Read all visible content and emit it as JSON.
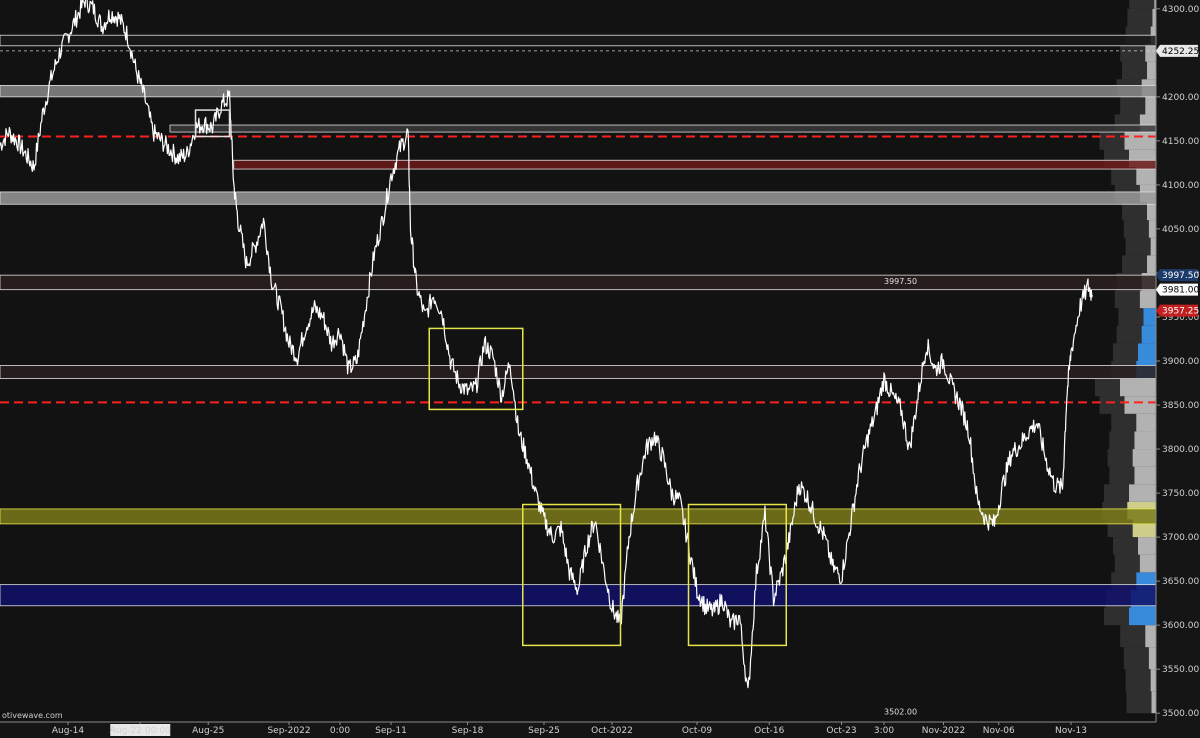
{
  "watermark": "otivewave.com",
  "chart_data": {
    "type": "line",
    "title": "",
    "xlabel": "",
    "ylabel": "",
    "ylim": [
      3490,
      4310
    ],
    "grid": false,
    "y_ticks": [
      3500,
      3550,
      3600,
      3650,
      3700,
      3750,
      3800,
      3850,
      3900,
      3950,
      4000,
      4050,
      4100,
      4150,
      4200,
      4250,
      4300
    ],
    "y_tick_labels": [
      "3500.00",
      "3550.00",
      "3600.00",
      "3650.00",
      "3700.00",
      "3750.00",
      "3800.00",
      "3850.00",
      "3900.00",
      "3950.00",
      "4000.00",
      "4050.00",
      "4100.00",
      "4150.00",
      "4200.00",
      "4250.00",
      "4300.00"
    ],
    "x_labels": [
      {
        "label": "Aug-14",
        "t": 8
      },
      {
        "label": "Aug-22 00:00",
        "t": 16.5,
        "highlight": true
      },
      {
        "label": "Aug-25",
        "t": 24.5
      },
      {
        "label": "Sep-2022",
        "t": 34
      },
      {
        "label": "0:00",
        "t": 40
      },
      {
        "label": "Sep-11",
        "t": 46
      },
      {
        "label": "Sep-18",
        "t": 55
      },
      {
        "label": "Sep-25",
        "t": 64
      },
      {
        "label": "Oct-2022",
        "t": 72
      },
      {
        "label": "Oct-09",
        "t": 82
      },
      {
        "label": "Oct-16",
        "t": 90.5
      },
      {
        "label": "Oct-23",
        "t": 99
      },
      {
        "label": "3:00",
        "t": 104
      },
      {
        "label": "Nov-2022",
        "t": 111
      },
      {
        "label": "Nov-06",
        "t": 117.5
      },
      {
        "label": "Nov-13",
        "t": 126
      }
    ],
    "t_range": [
      0,
      136
    ],
    "series": [
      {
        "color": "#ffffff",
        "points": [
          [
            0,
            4145
          ],
          [
            1,
            4160
          ],
          [
            2,
            4150
          ],
          [
            3,
            4135
          ],
          [
            4,
            4120
          ],
          [
            5,
            4180
          ],
          [
            6,
            4220
          ],
          [
            7,
            4250
          ],
          [
            8,
            4270
          ],
          [
            9,
            4290
          ],
          [
            10,
            4310
          ],
          [
            11,
            4300
          ],
          [
            12,
            4280
          ],
          [
            13,
            4295
          ],
          [
            14,
            4290
          ],
          [
            15,
            4270
          ],
          [
            16,
            4230
          ],
          [
            17,
            4200
          ],
          [
            18,
            4160
          ],
          [
            19,
            4150
          ],
          [
            20,
            4140
          ],
          [
            21,
            4130
          ],
          [
            22,
            4135
          ],
          [
            23,
            4165
          ],
          [
            24,
            4170
          ],
          [
            25,
            4165
          ],
          [
            26,
            4190
          ],
          [
            27,
            4200
          ],
          [
            27.5,
            4100
          ],
          [
            28,
            4060
          ],
          [
            29,
            4010
          ],
          [
            30,
            4030
          ],
          [
            31,
            4060
          ],
          [
            32,
            3990
          ],
          [
            33,
            3960
          ],
          [
            34,
            3920
          ],
          [
            35,
            3905
          ],
          [
            36,
            3940
          ],
          [
            37,
            3960
          ],
          [
            38,
            3950
          ],
          [
            39,
            3920
          ],
          [
            40,
            3935
          ],
          [
            41,
            3890
          ],
          [
            42,
            3900
          ],
          [
            43,
            3960
          ],
          [
            44,
            4020
          ],
          [
            45,
            4060
          ],
          [
            46,
            4110
          ],
          [
            47,
            4140
          ],
          [
            48,
            4160
          ],
          [
            48.3,
            4050
          ],
          [
            49,
            3985
          ],
          [
            50,
            3950
          ],
          [
            51,
            3975
          ],
          [
            52,
            3955
          ],
          [
            53,
            3900
          ],
          [
            54,
            3875
          ],
          [
            55,
            3865
          ],
          [
            56,
            3870
          ],
          [
            57,
            3920
          ],
          [
            58,
            3905
          ],
          [
            59,
            3860
          ],
          [
            60,
            3900
          ],
          [
            61,
            3820
          ],
          [
            62,
            3790
          ],
          [
            63,
            3750
          ],
          [
            64,
            3720
          ],
          [
            65,
            3700
          ],
          [
            66,
            3710
          ],
          [
            67,
            3660
          ],
          [
            68,
            3640
          ],
          [
            69,
            3690
          ],
          [
            70,
            3720
          ],
          [
            71,
            3665
          ],
          [
            72,
            3620
          ],
          [
            73,
            3600
          ],
          [
            74,
            3700
          ],
          [
            75,
            3760
          ],
          [
            76,
            3800
          ],
          [
            77,
            3815
          ],
          [
            78,
            3790
          ],
          [
            79,
            3750
          ],
          [
            80,
            3740
          ],
          [
            81,
            3690
          ],
          [
            82,
            3640
          ],
          [
            83,
            3620
          ],
          [
            84,
            3615
          ],
          [
            85,
            3630
          ],
          [
            86,
            3600
          ],
          [
            87,
            3610
          ],
          [
            88,
            3520
          ],
          [
            89,
            3660
          ],
          [
            90,
            3725
          ],
          [
            91,
            3630
          ],
          [
            92,
            3660
          ],
          [
            93,
            3705
          ],
          [
            94,
            3760
          ],
          [
            95,
            3745
          ],
          [
            96,
            3720
          ],
          [
            97,
            3700
          ],
          [
            98,
            3665
          ],
          [
            99,
            3655
          ],
          [
            100,
            3710
          ],
          [
            101,
            3770
          ],
          [
            102,
            3810
          ],
          [
            103,
            3840
          ],
          [
            104,
            3880
          ],
          [
            105,
            3860
          ],
          [
            106,
            3845
          ],
          [
            107,
            3800
          ],
          [
            108,
            3860
          ],
          [
            109,
            3920
          ],
          [
            110,
            3890
          ],
          [
            111,
            3900
          ],
          [
            112,
            3870
          ],
          [
            113,
            3850
          ],
          [
            114,
            3820
          ],
          [
            115,
            3740
          ],
          [
            116,
            3720
          ],
          [
            117,
            3715
          ],
          [
            118,
            3760
          ],
          [
            119,
            3795
          ],
          [
            120,
            3805
          ],
          [
            121,
            3820
          ],
          [
            122,
            3830
          ],
          [
            123,
            3790
          ],
          [
            124,
            3760
          ],
          [
            125,
            3755
          ],
          [
            125.5,
            3860
          ],
          [
            126,
            3910
          ],
          [
            127,
            3960
          ],
          [
            128,
            3985
          ],
          [
            128.5,
            3975
          ]
        ]
      }
    ],
    "zones": [
      {
        "low": 4258,
        "high": 4270,
        "fill": "#1a1a1a",
        "stroke": "#e0e0e0"
      },
      {
        "low": 4200,
        "high": 4213,
        "fill": "#8a8a8a",
        "stroke": "#e0e0e0"
      },
      {
        "low": 4160,
        "high": 4168,
        "fill": "#3a3a3a",
        "stroke": "#e0e0e0",
        "t_start": 20
      },
      {
        "low": 4078,
        "high": 4092,
        "fill": "#9a9a9a",
        "stroke": "#e0e0e0"
      },
      {
        "low": 4118,
        "high": 4128,
        "fill": "#6b1a1a",
        "stroke": "#e0e0e0",
        "t_start": 27.5
      },
      {
        "low": 3981,
        "high": 3997.5,
        "fill": "#2c2020",
        "stroke": "#e0e0e0"
      },
      {
        "low": 3880,
        "high": 3895,
        "fill": "#2a2020",
        "stroke": "#e0e0e0"
      },
      {
        "low": 3715,
        "high": 3732,
        "fill": "#7a7a1a",
        "stroke": "#e8e850"
      },
      {
        "low": 3622,
        "high": 3646,
        "fill": "#10106a",
        "stroke": "#e0e0e0"
      }
    ],
    "dashed_lines": [
      {
        "y": 4252.25,
        "color": "#cccccc"
      },
      {
        "y": 4155,
        "color": "#ff2020"
      },
      {
        "y": 3853,
        "color": "#ff2020"
      }
    ],
    "boxes": [
      {
        "t0": 23,
        "t1": 27,
        "y0": 4155,
        "y1": 4185,
        "color": "#e0e0e0"
      },
      {
        "t0": 50.5,
        "t1": 61.5,
        "y0": 3845,
        "y1": 3937,
        "color": "#e6e64a"
      },
      {
        "t0": 61.5,
        "t1": 73,
        "y0": 3577,
        "y1": 3737,
        "color": "#e6e64a"
      },
      {
        "t0": 81,
        "t1": 92.5,
        "y0": 3577,
        "y1": 3737,
        "color": "#e6e64a"
      }
    ],
    "level_labels": [
      {
        "text": "3997.50",
        "y": 3991,
        "t": 104
      },
      {
        "text": "3502.00",
        "y": 3502,
        "t": 104
      }
    ],
    "price_tags": [
      {
        "text": "4252.25",
        "y": 4252.25,
        "bg": "#e8e8e8",
        "fg": "#000000"
      },
      {
        "text": "3997.50",
        "y": 3997.5,
        "bg": "#1c3a6a",
        "fg": "#ffffff"
      },
      {
        "text": "3981.00",
        "y": 3981,
        "bg": "#ffffff",
        "fg": "#000000"
      },
      {
        "text": "3957.25",
        "y": 3957.25,
        "bg": "#c22020",
        "fg": "#ffffff"
      }
    ],
    "volume_profile": {
      "bins": [
        [
          3500,
          0.05
        ],
        [
          3525,
          0.06
        ],
        [
          3550,
          0.08
        ],
        [
          3575,
          0.12
        ],
        [
          3600,
          0.3
        ],
        [
          3620,
          0.28
        ],
        [
          3640,
          0.22
        ],
        [
          3660,
          0.18
        ],
        [
          3680,
          0.2
        ],
        [
          3700,
          0.26
        ],
        [
          3720,
          0.32
        ],
        [
          3740,
          0.3
        ],
        [
          3760,
          0.24
        ],
        [
          3780,
          0.26
        ],
        [
          3800,
          0.24
        ],
        [
          3820,
          0.22
        ],
        [
          3840,
          0.35
        ],
        [
          3860,
          0.4
        ],
        [
          3880,
          0.22
        ],
        [
          3900,
          0.2
        ],
        [
          3920,
          0.16
        ],
        [
          3940,
          0.14
        ],
        [
          3960,
          0.18
        ],
        [
          3980,
          0.16
        ],
        [
          4000,
          0.1
        ],
        [
          4020,
          0.06
        ],
        [
          4040,
          0.08
        ],
        [
          4060,
          0.1
        ],
        [
          4080,
          0.18
        ],
        [
          4100,
          0.22
        ],
        [
          4120,
          0.3
        ],
        [
          4140,
          0.35
        ],
        [
          4160,
          0.18
        ],
        [
          4180,
          0.12
        ],
        [
          4200,
          0.16
        ],
        [
          4220,
          0.1
        ],
        [
          4240,
          0.12
        ],
        [
          4260,
          0.06
        ],
        [
          4280,
          0.04
        ],
        [
          4300,
          0.02
        ]
      ],
      "colors": {
        "main": "#cfcfcf",
        "dark": "#3c3c3c",
        "blue": "#3fa0ff",
        "highlight": "#f0f0a0"
      }
    }
  }
}
